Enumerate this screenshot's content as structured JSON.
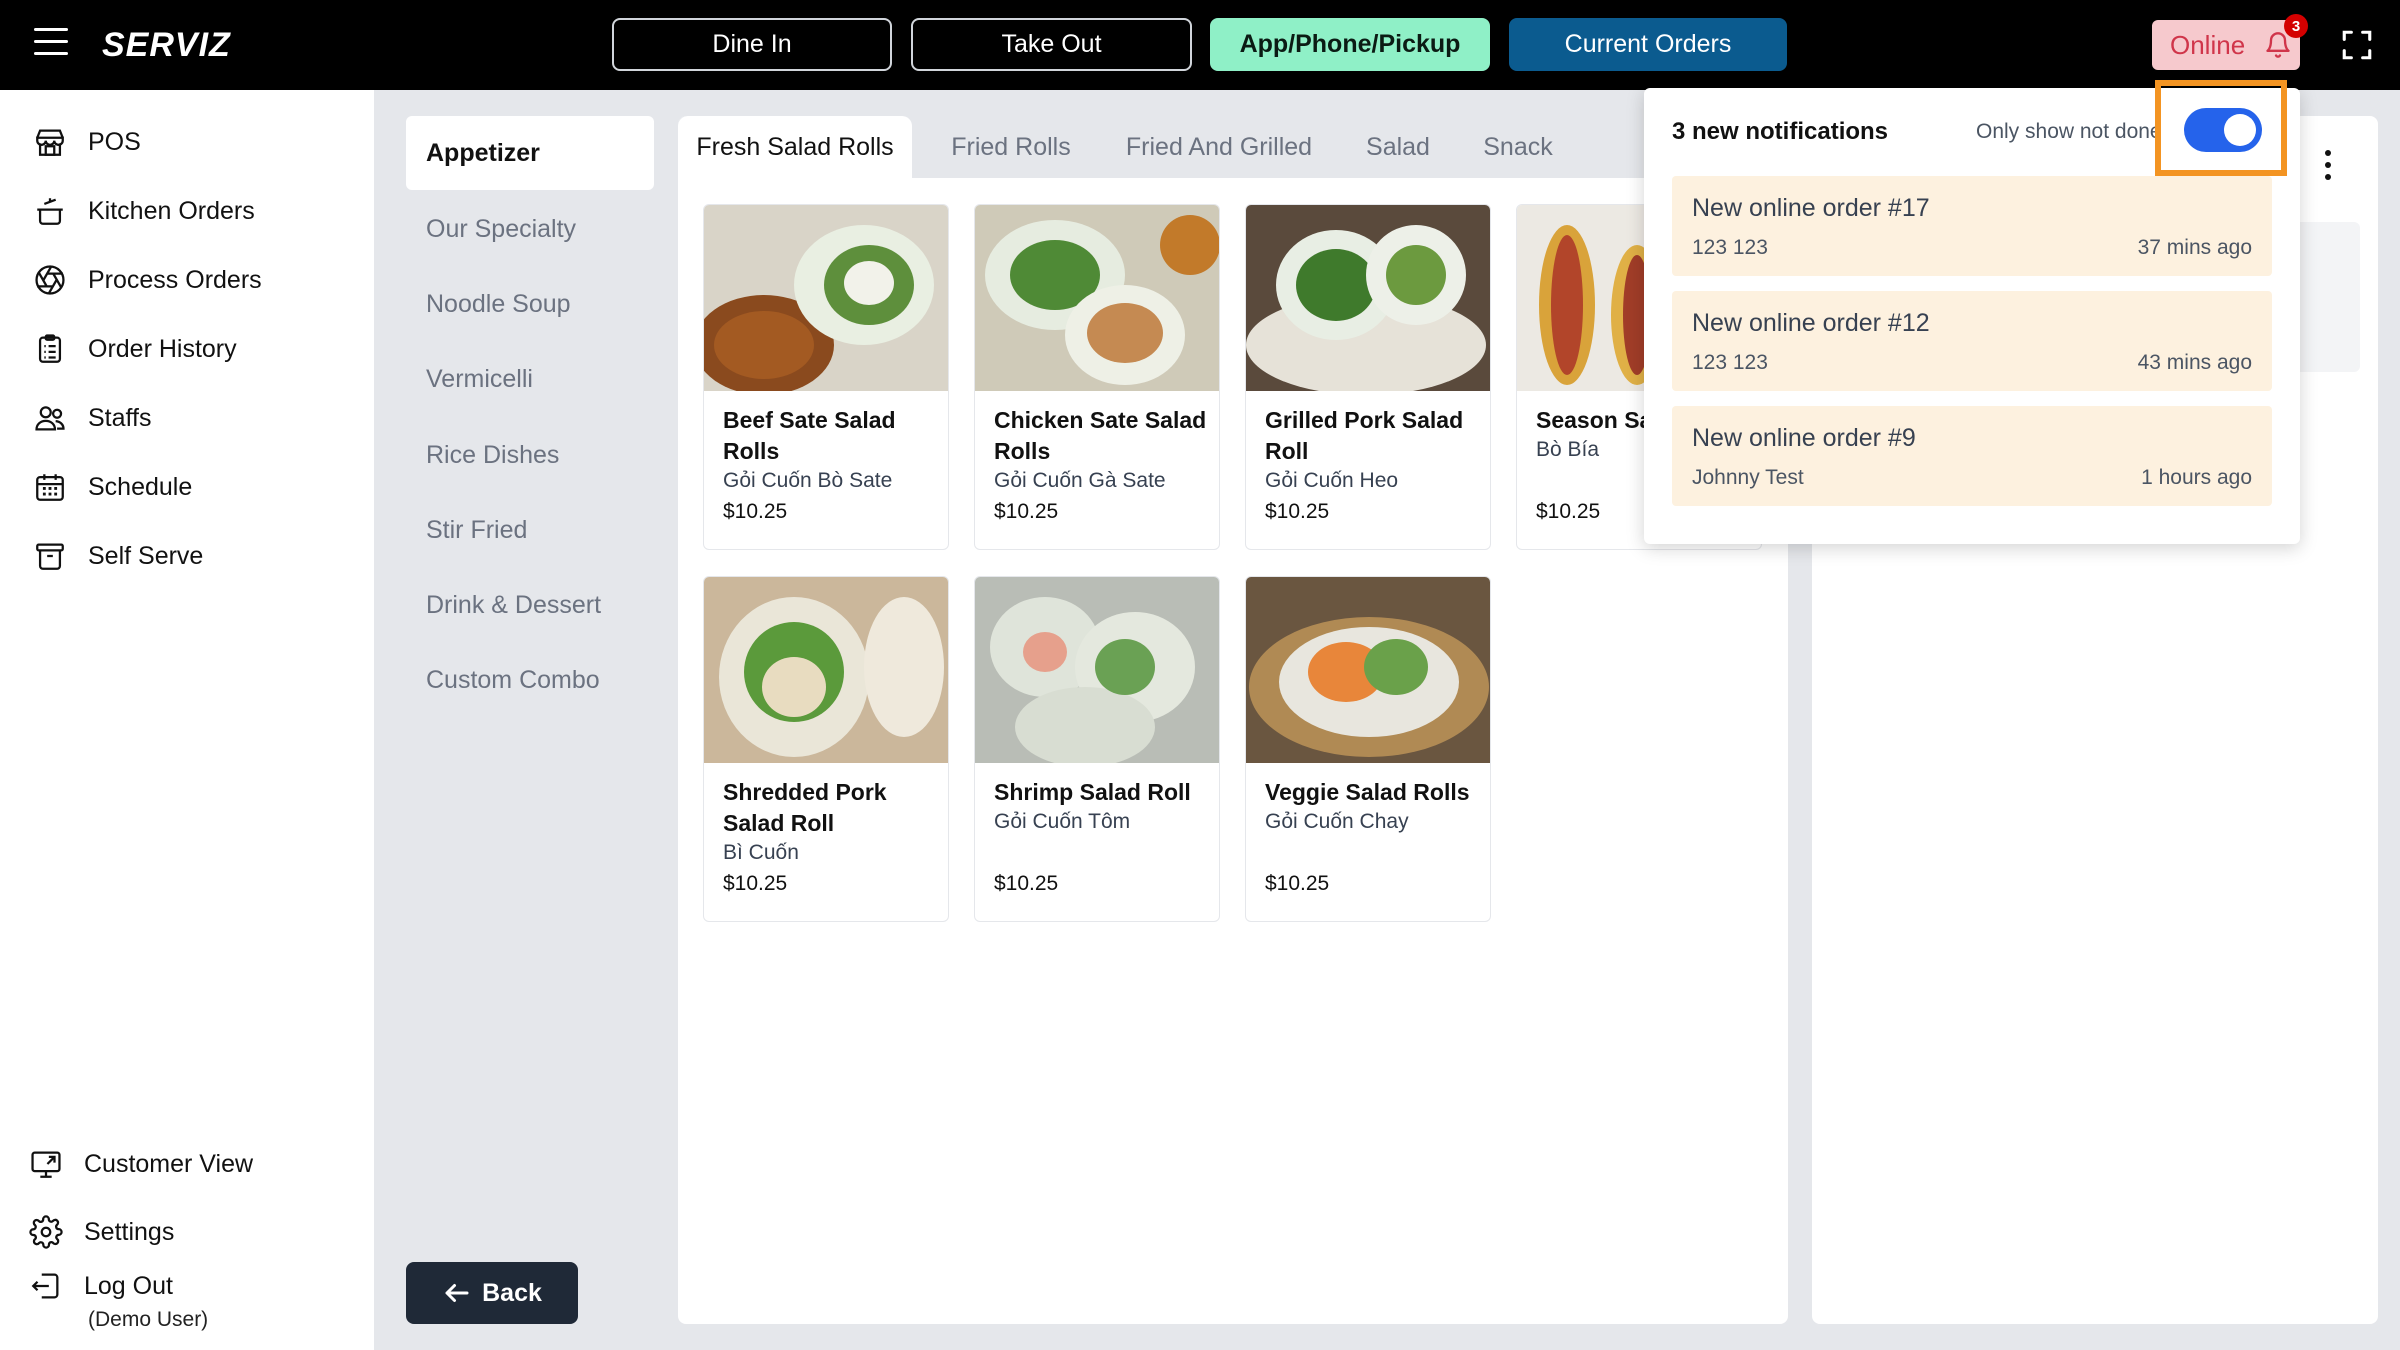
{
  "app": {
    "brand": "SERVIZ"
  },
  "modes": [
    {
      "label": "Dine In"
    },
    {
      "label": "Take Out"
    },
    {
      "label": "App/Phone/Pickup"
    },
    {
      "label": "Current Orders"
    }
  ],
  "status": {
    "online_label": "Online",
    "notification_count": "3"
  },
  "nav": {
    "items": [
      {
        "label": "POS",
        "icon": "store-icon"
      },
      {
        "label": "Kitchen Orders",
        "icon": "cooking-pot-icon"
      },
      {
        "label": "Process Orders",
        "icon": "aperture-icon"
      },
      {
        "label": "Order History",
        "icon": "clipboard-list-icon"
      },
      {
        "label": "Staffs",
        "icon": "users-icon"
      },
      {
        "label": "Schedule",
        "icon": "calendar-icon"
      },
      {
        "label": "Self Serve",
        "icon": "archive-box-icon"
      }
    ],
    "bottom": [
      {
        "label": "Customer View",
        "icon": "monitor-icon"
      },
      {
        "label": "Settings",
        "icon": "gear-icon"
      },
      {
        "label": "Log Out",
        "icon": "logout-icon"
      }
    ],
    "user": "(Demo User)"
  },
  "categories": [
    "Appetizer",
    "Our Specialty",
    "Noodle Soup",
    "Vermicelli",
    "Rice Dishes",
    "Stir Fried",
    "Drink & Dessert",
    "Custom Combo"
  ],
  "back_label": "Back",
  "tabs": [
    "Fresh Salad Rolls",
    "Fried Rolls",
    "Fried And Grilled",
    "Salad",
    "Snack"
  ],
  "products": [
    {
      "name": "Beef Sate Salad Rolls",
      "sub": "Gỏi Cuốn Bò Sate",
      "price": "$10.25"
    },
    {
      "name": "Chicken Sate Salad Rolls",
      "sub": "Gỏi Cuốn Gà Sate",
      "price": "$10.25"
    },
    {
      "name": "Grilled Pork Salad Roll",
      "sub": "Gỏi Cuốn Heo",
      "price": "$10.25"
    },
    {
      "name": "Season Sa",
      "sub": "Bò Bía",
      "price": "$10.25"
    },
    {
      "name": "Shredded Pork Salad Roll",
      "sub": "Bì Cuốn",
      "price": "$10.25"
    },
    {
      "name": "Shrimp Salad Roll",
      "sub": "Gỏi Cuốn Tôm",
      "price": "$10.25"
    },
    {
      "name": "Veggie Salad Rolls",
      "sub": "Gỏi Cuốn Chay",
      "price": "$10.25"
    }
  ],
  "notifications": {
    "title": "3 new notifications",
    "filter_label": "Only show not done",
    "toggle_on": true,
    "items": [
      {
        "title": "New online order #17",
        "customer": "123 123",
        "time": "37 mins ago"
      },
      {
        "title": "New online order #12",
        "customer": "123 123",
        "time": "43 mins ago"
      },
      {
        "title": "New online order #9",
        "customer": "Johnny Test",
        "time": "1 hours ago"
      }
    ]
  },
  "colors": {
    "accent_green": "#8ff0c7",
    "accent_blue": "#0b5b8f",
    "online_bg": "#f6c9cd",
    "highlight": "#f39422",
    "notification_bg": "#fdf1df"
  }
}
